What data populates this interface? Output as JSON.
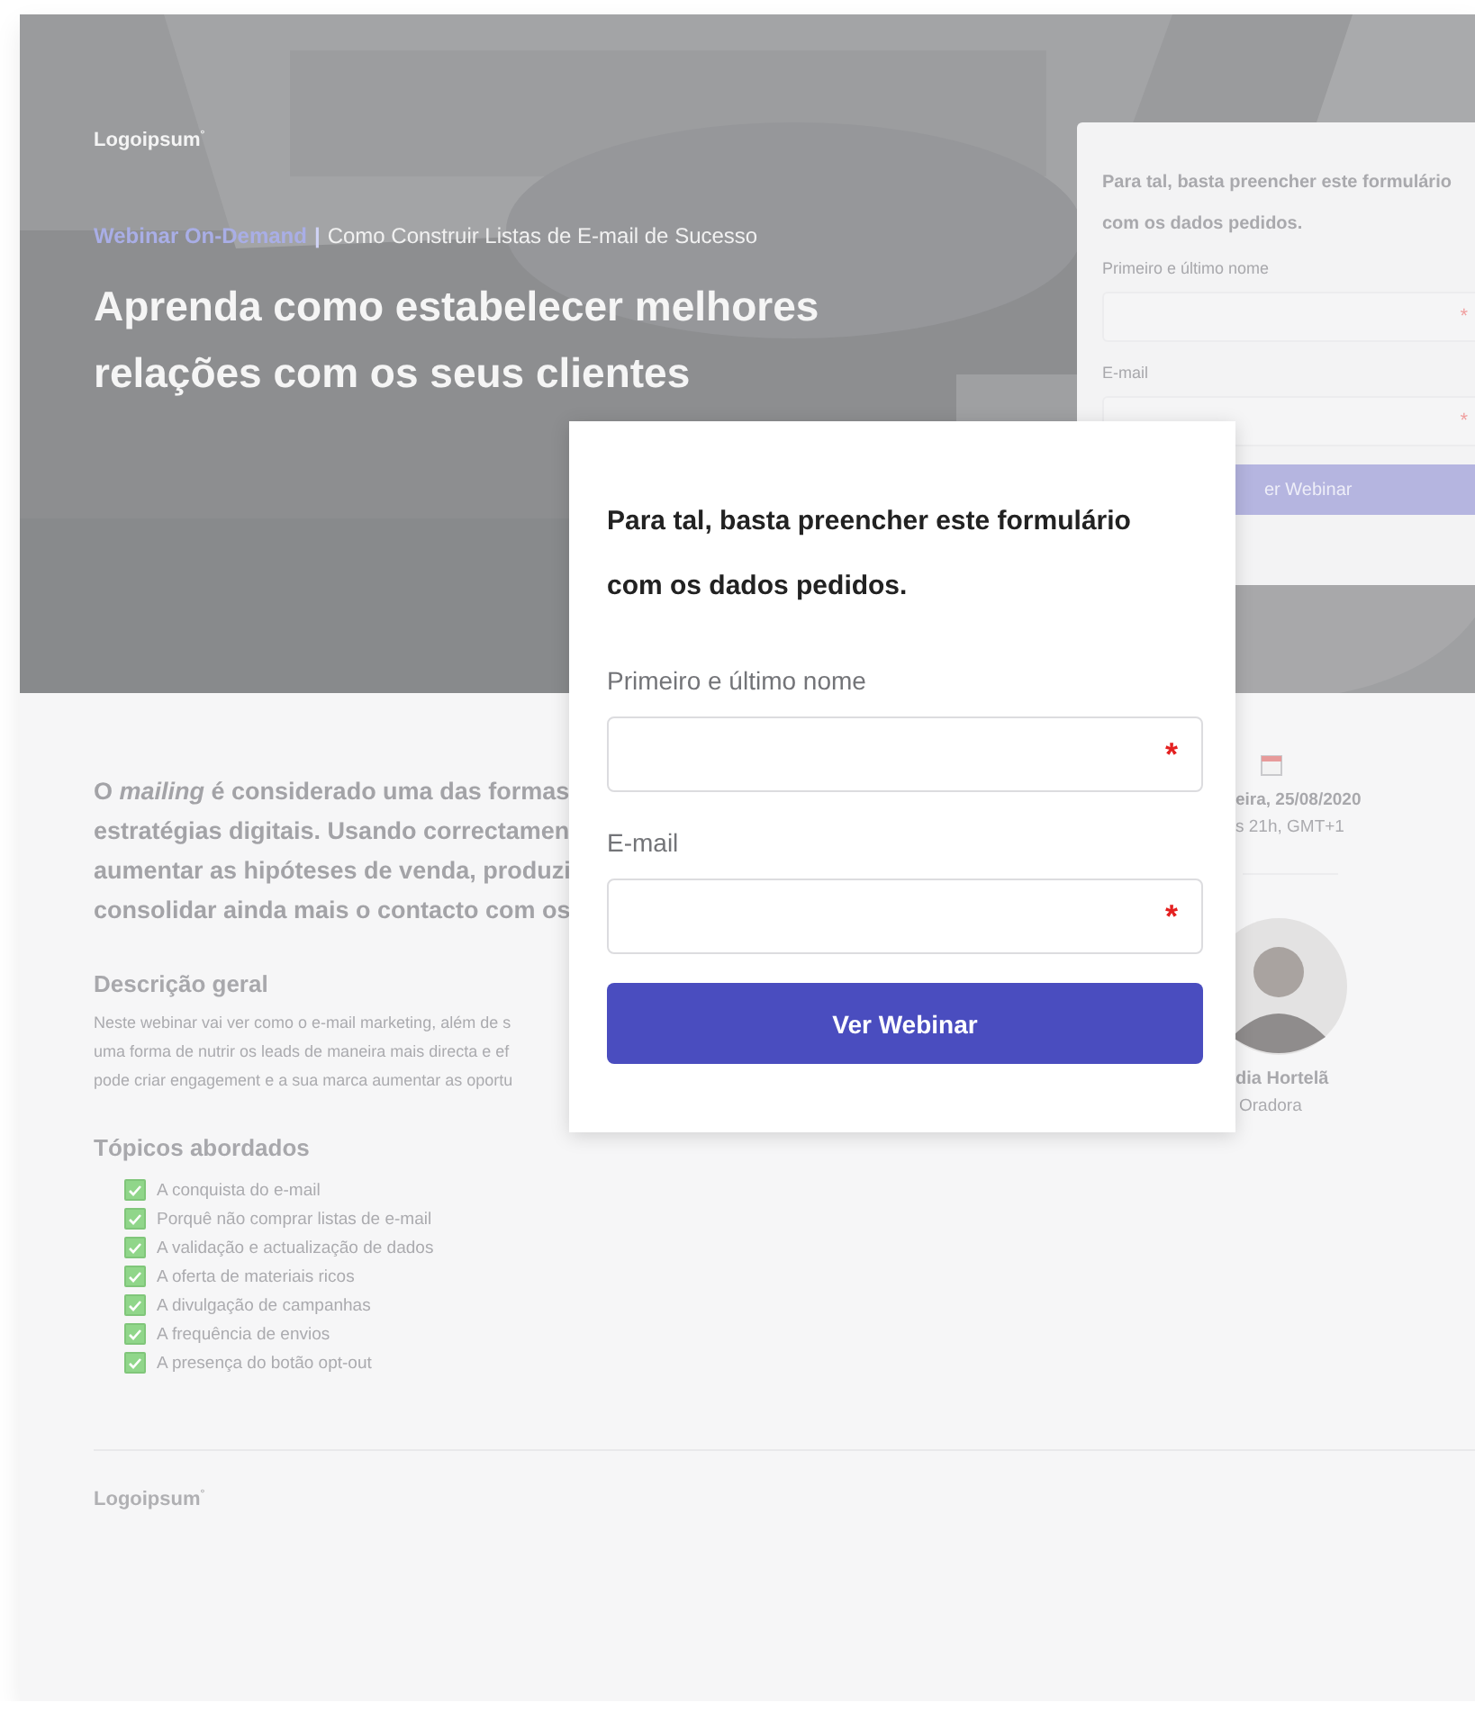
{
  "hero": {
    "logo": "Logoipsum$^{°}$",
    "tag": "Webinar On-Demand",
    "separator": "|",
    "subtitle": "Como Construir Listas de E-mail de Sucesso",
    "headline_lines": [
      "Aprenda como estabelecer melhores",
      "relações com os seus clientes"
    ],
    "form_card": {
      "title_lines": [
        "Para tal, basta preencher este formulário",
        "com os dados pedidos."
      ],
      "fields": [
        {
          "label": "Primeiro e último nome",
          "required_mark": "*"
        },
        {
          "label": "E-mail",
          "required_mark": "*"
        }
      ],
      "button": "er Webinar"
    }
  },
  "content": {
    "intro_lines": [
      "O *mailing* é considerado uma das formas",
      "estratégias digitais. Usando correctamen",
      "aumentar as hipóteses de venda, produzi",
      "consolidar ainda mais o contacto com os"
    ],
    "description": {
      "heading": "Descrição geral",
      "lines": [
        "Neste webinar vai ver como o e-mail marketing, além de s",
        "uma forma de nutrir os leads de maneira mais directa e ef",
        "pode criar engagement e a sua marca aumentar as oportu"
      ]
    },
    "topics": {
      "heading": "Tópicos abordados",
      "items": [
        {
          "label": "A conquista do e-mail",
          "checked": true
        },
        {
          "label": "Porquê não comprar listas de e-mail",
          "checked": true
        },
        {
          "label": "A validação e actualização de dados",
          "checked": true
        },
        {
          "label": "A oferta de materiais ricos",
          "checked": true
        },
        {
          "label": "A divulgação de campanhas",
          "checked": true
        },
        {
          "label": "A frequência de envios",
          "checked": true
        },
        {
          "label": "A presença do botão opt-out",
          "checked": true
        }
      ]
    }
  },
  "event": {
    "date": "eira, 25/08/2020",
    "time": "s 21h, GMT+1"
  },
  "speaker": {
    "name": "dia Hortelã",
    "role": "Oradora"
  },
  "footer": {
    "logo": "Logoipsum$^{°}$"
  },
  "popup": {
    "title_lines": [
      "Para tal, basta preencher este formulário",
      "com os dados pedidos."
    ],
    "fields": [
      {
        "label": "Primeiro e último nome",
        "required_mark": "*"
      },
      {
        "label": "E-mail",
        "required_mark": "*"
      }
    ],
    "button": "Ver Webinar"
  }
}
